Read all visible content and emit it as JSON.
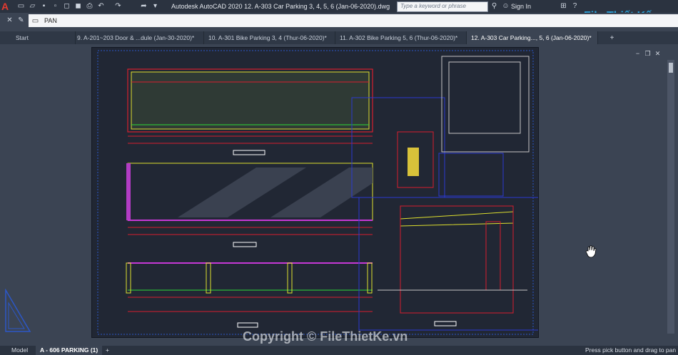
{
  "app": {
    "title": "Autodesk AutoCAD 2020    12. A-303 Car Parking 3, 4, 5, 6 (Jan-06-2020).dwg",
    "search_placeholder": "Type a keyword or phrase",
    "sign_in": "Sign In"
  },
  "command": {
    "current": "PAN"
  },
  "tabs": [
    {
      "label": "Start"
    },
    {
      "label": "9. A-201~203 Door & ...dule (Jan-30-2020)*"
    },
    {
      "label": "10. A-301 Bike Parking 3, 4 (Thur-06-2020)*"
    },
    {
      "label": "11. A-302 Bike Parking 5, 6 (Thur-06-2020)*"
    },
    {
      "label": "12. A-303 Car Parking..., 5, 6 (Jan-06-2020)*"
    }
  ],
  "layouts": {
    "model": "Model",
    "active": "A - 606 PARKING (1)",
    "add": "+"
  },
  "status": {
    "prompt": "Press pick button and drag to pan"
  },
  "watermark": {
    "copyright": "Copyright © FileThietKe.vn",
    "logo": "File Thiết Kế.vn"
  },
  "colors": {
    "accent": "#e43a2f",
    "canvas": "#212734",
    "ui": "#3b4453"
  }
}
